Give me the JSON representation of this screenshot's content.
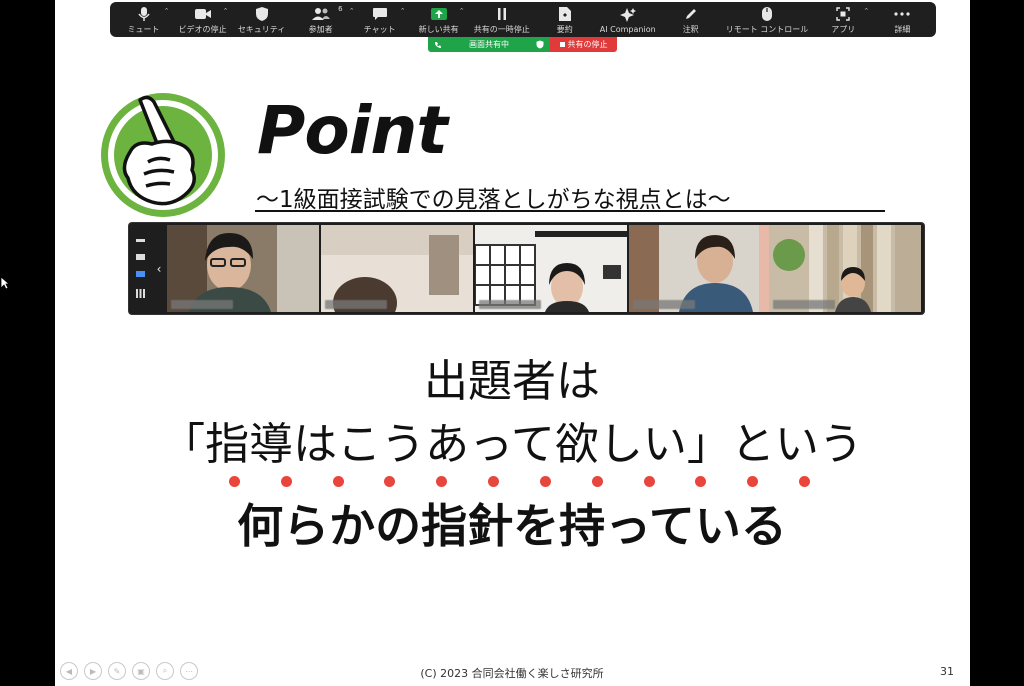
{
  "toolbar": {
    "items": [
      {
        "label": "ミュート",
        "icon": "microphone-icon"
      },
      {
        "label": "ビデオの停止",
        "icon": "video-camera-icon"
      },
      {
        "label": "セキュリティ",
        "icon": "shield-icon"
      },
      {
        "label": "参加者",
        "icon": "participants-icon",
        "badge": "6"
      },
      {
        "label": "チャット",
        "icon": "chat-bubble-icon"
      },
      {
        "label": "新しい共有",
        "icon": "share-screen-icon"
      },
      {
        "label": "共有の一時停止",
        "icon": "pause-icon"
      },
      {
        "label": "要約",
        "icon": "summary-document-icon"
      },
      {
        "label": "AI Companion",
        "icon": "sparkle-icon"
      },
      {
        "label": "注釈",
        "icon": "pencil-icon"
      },
      {
        "label": "リモート コントロール",
        "icon": "mouse-icon"
      },
      {
        "label": "アプリ",
        "icon": "apps-icon"
      },
      {
        "label": "詳細",
        "icon": "more-dots-icon"
      }
    ]
  },
  "share_status": {
    "sharing_label": "画面共有中",
    "stop_label": "共有の停止"
  },
  "slide": {
    "heading": "Point",
    "subheading": "～1級面接試験での見落としがちな視点とは～",
    "line1": "出題者は",
    "line2": "「指導はこうあって欲しい」という",
    "line3": "何らかの指針を持っている",
    "emphasis_dot_count": 12,
    "footer": "(C) 2023 合同会社働く楽しさ研究所",
    "page_number": "31"
  },
  "colors": {
    "toolbar_bg": "#1f1f1f",
    "share_green": "#1fa44a",
    "stop_red": "#e03a3a",
    "logo_green": "#6cb33f",
    "emphasis_dot": "#e8453c"
  }
}
